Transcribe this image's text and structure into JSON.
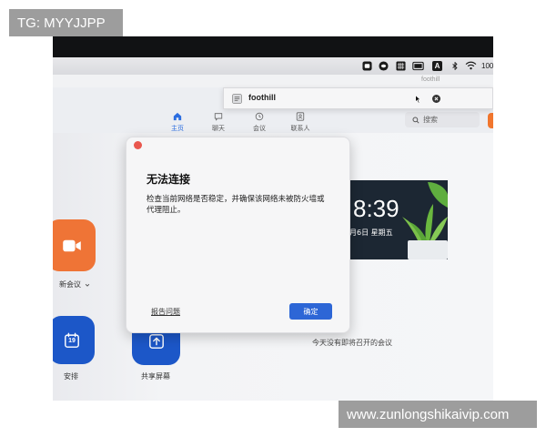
{
  "watermarks": {
    "top_left": "TG: MYYJJPP",
    "bottom_right": "www.zunlongshikaivip.com"
  },
  "menubar": {
    "icons": [
      "record-icon",
      "meeting-app-icon",
      "grid-icon",
      "card-icon",
      "input-source-icon",
      "bluetooth-icon",
      "wifi-icon"
    ],
    "input_source": "A",
    "battery": "100"
  },
  "window": {
    "title": "foothill"
  },
  "account_popup": {
    "name": "foothill",
    "icons": [
      "account-icon",
      "cursor-icon",
      "clear-icon"
    ]
  },
  "nav": {
    "tabs": [
      {
        "label": "主页",
        "icon": "home-icon",
        "active": true
      },
      {
        "label": "聊天",
        "icon": "chat-icon",
        "active": false
      },
      {
        "label": "会议",
        "icon": "clock-icon",
        "active": false
      },
      {
        "label": "联系人",
        "icon": "contacts-icon",
        "active": false
      }
    ]
  },
  "search": {
    "placeholder": "搜索",
    "icon": "search-icon"
  },
  "actions": {
    "new_meeting": {
      "label": "新会议",
      "icon": "video-camera-icon"
    },
    "schedule": {
      "label": "安排",
      "day": "19",
      "icon": "calendar-icon"
    },
    "share_screen": {
      "label": "共享屏幕",
      "icon": "share-screen-icon"
    }
  },
  "clock": {
    "time": "8:39",
    "date": "月6日 星期五"
  },
  "meetings": {
    "empty_text": "今天没有即将召开的会议"
  },
  "dialog": {
    "title": "无法连接",
    "message_lines": [
      "检查当前网络是否稳定，并确保该网络未被防火墙或",
      "代理阻止。"
    ],
    "report_label": "报告问题",
    "ok_label": "确定"
  },
  "colors": {
    "accent_blue": "#2d66d6",
    "tile_blue": "#1c57c8",
    "orange": "#ef7436",
    "close_red": "#e9574e",
    "clock_bg": "#1c2733"
  }
}
